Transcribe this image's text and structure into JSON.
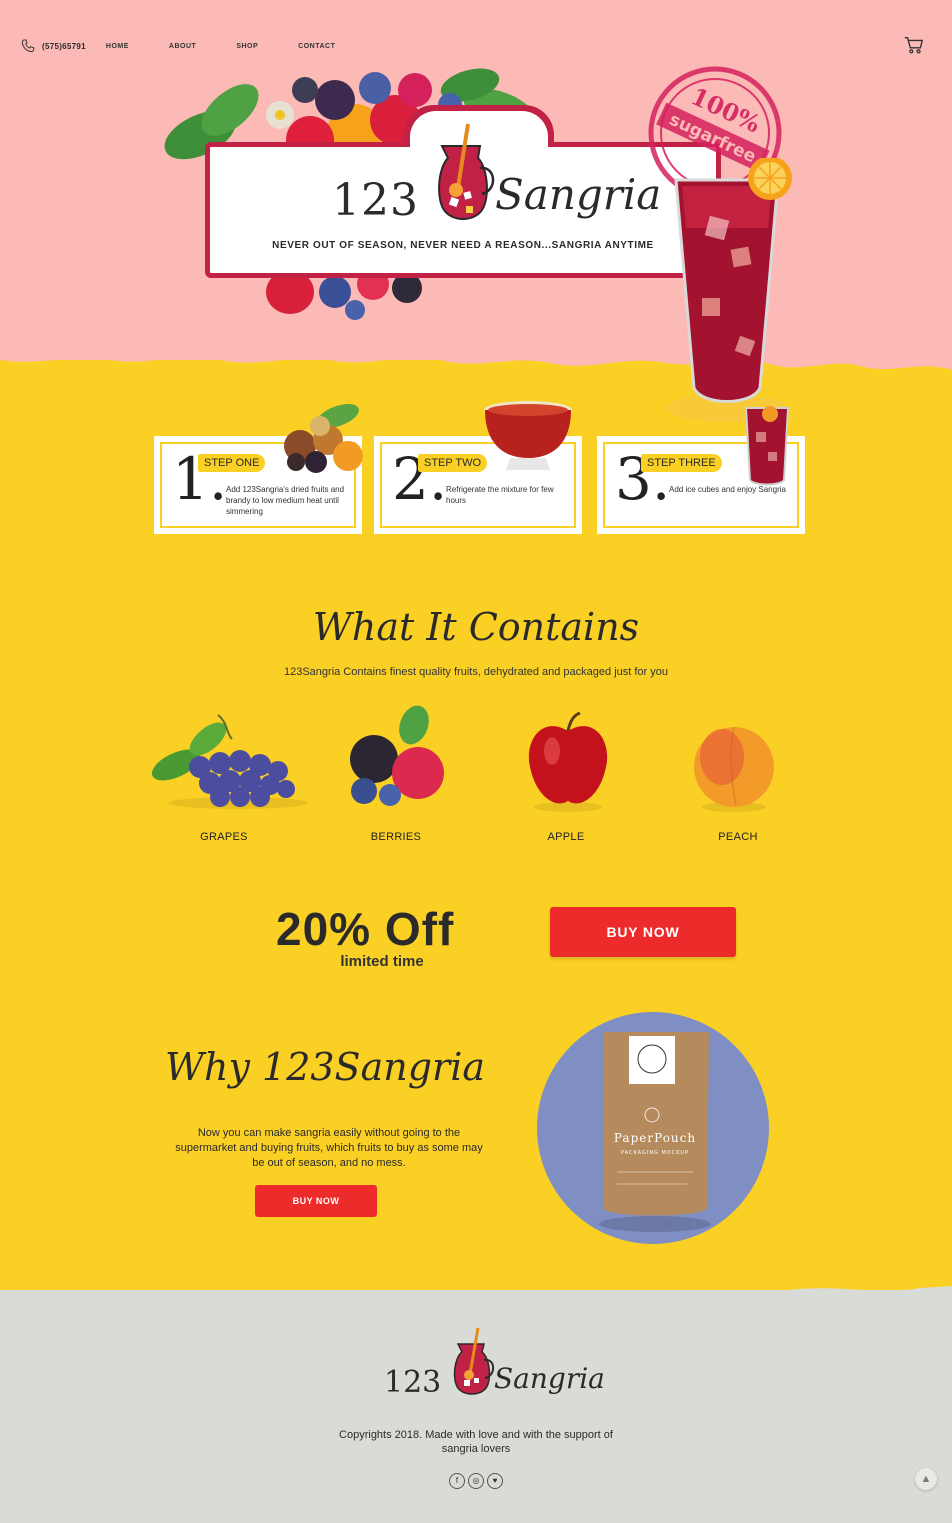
{
  "nav": {
    "phone": "(575)65791",
    "links": [
      "HOME",
      "ABOUT",
      "SHOP",
      "CONTACT"
    ]
  },
  "hero": {
    "logo_number": "123",
    "logo_word": "Sangria",
    "tagline": "NEVER OUT OF SEASON, NEVER NEED A REASON...SANGRIA ANYTIME",
    "stamp_top": "100%",
    "stamp_band": "sugarfree"
  },
  "steps": [
    {
      "number": "1.",
      "label": "STEP ONE",
      "text": "Add 123Sangria's dried fruits and brandy to low medium heat until simmering"
    },
    {
      "number": "2.",
      "label": "STEP TWO",
      "text": "Refrigerate the mixture for few hours"
    },
    {
      "number": "3.",
      "label": "STEP THREE",
      "text": "Add ice cubes and enjoy Sangria"
    }
  ],
  "contains": {
    "title": "What It Contains",
    "subtitle": "123Sangria Contains finest quality fruits, dehydrated and packaged just for you",
    "fruits": [
      "GRAPES",
      "BERRIES",
      "APPLE",
      "PEACH"
    ]
  },
  "offer": {
    "headline": "20% Off",
    "sub": "limited time",
    "button": "BUY NOW"
  },
  "why": {
    "title": "Why 123Sangria",
    "text": "Now you can make sangria  easily without going to the supermarket and buying fruits, which fruits to buy as some may be out of season, and no mess.",
    "button": "BUY NOW",
    "pouch_title": "PaperPouch",
    "pouch_sub": "PACKAGING MOCKUP"
  },
  "footer": {
    "logo_number": "123",
    "logo_word": "Sangria",
    "copyright": "Copyrights 2018. Made with love and with the support of sangria lovers",
    "social": [
      "f",
      "◎",
      "♥"
    ],
    "to_top": "▲"
  },
  "colors": {
    "pink": "#fbbab6",
    "yellow": "#fbd024",
    "crimson": "#c22146",
    "red_button": "#ee2b2b",
    "footer_grey": "#d9dcd6"
  }
}
